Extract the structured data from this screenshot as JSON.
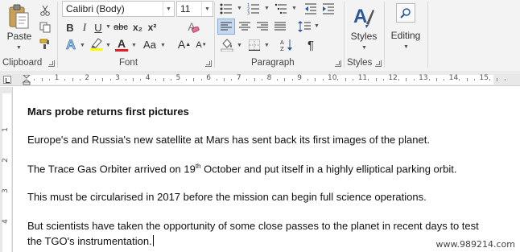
{
  "ribbon": {
    "clipboard": {
      "label": "Clipboard",
      "paste": "Paste"
    },
    "font": {
      "label": "Font",
      "name_value": "Calibri (Body)",
      "size_value": "11",
      "grow": "A",
      "shrink": "A",
      "case": "Aa",
      "bold": "B",
      "italic": "I",
      "underline": "U",
      "strike": "abc",
      "subscript": "x₂",
      "superscript": "x²",
      "text_effects": "A",
      "font_color": "A",
      "clear": "A"
    },
    "paragraph": {
      "label": "Paragraph",
      "pilcrow": "¶"
    },
    "styles": {
      "label": "Styles",
      "button": "Styles"
    },
    "editing": {
      "button": "Editing"
    }
  },
  "ruler": {
    "numbers": [
      "1",
      "2",
      "3",
      "4",
      "5",
      "6",
      "7",
      "8",
      "9",
      "10",
      "11",
      "12",
      "13",
      "14",
      "15"
    ],
    "vertical_numbers": [
      "1",
      "2",
      "3",
      "4"
    ]
  },
  "document": {
    "title": "Mars probe returns first pictures",
    "p1": "Europe's and Russia's new satellite at Mars has sent back its first images of the planet.",
    "p2_before": "The Trace Gas Orbiter arrived on 19",
    "p2_sup": "th",
    "p2_after": " October and put itself in a highly elliptical parking orbit.",
    "p3": "This must be circularised in 2017 before the mission can begin full science operations.",
    "p4_line1": "But scientists have taken the opportunity of some close passes to the planet in recent days to test",
    "p4_line2": "the TGO's instrumentation."
  },
  "watermark": "www.989214.com",
  "colors": {
    "ribbon_bg": "#f3f3f3",
    "highlight_yellow": "#ffff00",
    "font_red": "#e51c23",
    "accent_blue": "#2b579a",
    "active_align_bg": "#c5d9f1"
  }
}
